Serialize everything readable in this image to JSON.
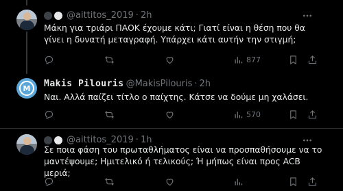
{
  "tweets": [
    {
      "display_name": "",
      "handle": "@aittitos_2019",
      "separator": "·",
      "time": "2h",
      "text": "Μάκη για τριάρι ΠΑΟΚ έχουμε κάτι; Γιατί είναι η θέση που θα γίνει η δυνατή μεταγραφή. Υπάρχει κάτι αυτήν την στιγμή;",
      "views": "877"
    },
    {
      "display_name": "Makis Pilouris",
      "avatar_letter": "M",
      "handle": "@MakisPilouris",
      "separator": "·",
      "time": "2h",
      "text": "Ναι. Αλλά παίζει τίτλο ο παίχτης. Κάτσε να δούμε μη χαλάσει.",
      "views": "570"
    },
    {
      "display_name": "",
      "handle": "@aittitos_2019",
      "separator": "·",
      "time": "1h",
      "text": "Σε ποια φάση του πρωταθλήματος είναι να προσπαθήσουμε να το μαντέψουμε; Ημιτελικό ή τελικούς; Ή μήπως είναι προς ACB μεριά;",
      "views": ""
    }
  ],
  "icons": {
    "more": "more-horizontal-icon",
    "reply": "reply-icon",
    "retweet": "retweet-icon",
    "like": "heart-icon",
    "views": "views-bar-chart-icon",
    "bookmark": "bookmark-icon",
    "share": "share-icon"
  },
  "colors": {
    "background": "#000000",
    "text": "#e7e9ea",
    "secondary": "#71767b",
    "divider": "#2f3336"
  }
}
